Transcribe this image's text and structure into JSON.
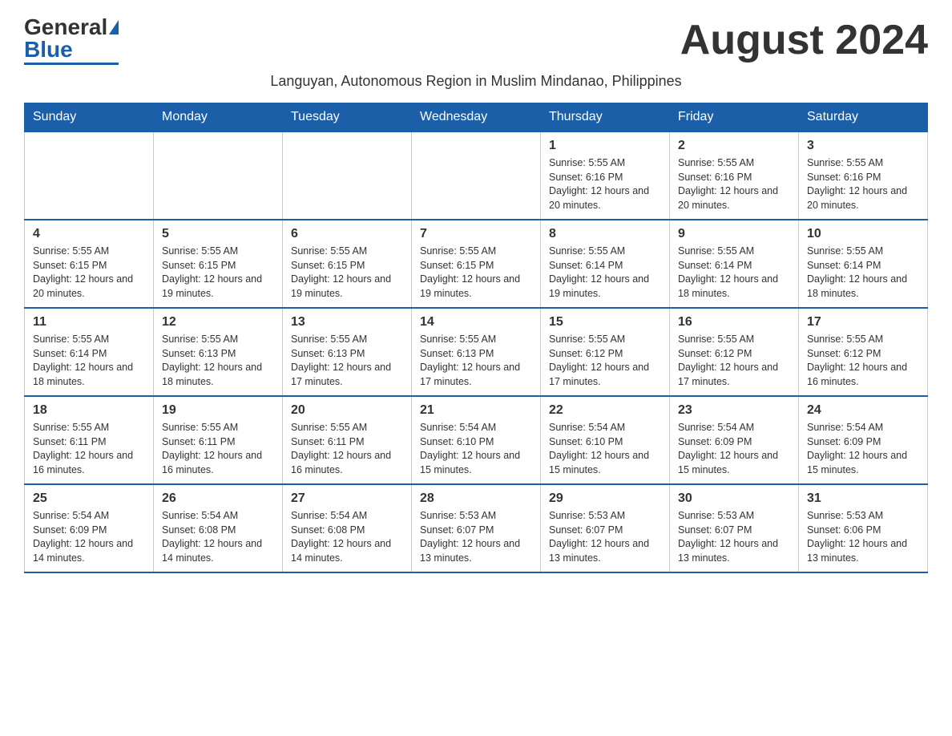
{
  "logo": {
    "general": "General",
    "blue": "Blue"
  },
  "title": "August 2024",
  "subtitle": "Languyan, Autonomous Region in Muslim Mindanao, Philippines",
  "days_of_week": [
    "Sunday",
    "Monday",
    "Tuesday",
    "Wednesday",
    "Thursday",
    "Friday",
    "Saturday"
  ],
  "weeks": [
    [
      {
        "day": "",
        "info": ""
      },
      {
        "day": "",
        "info": ""
      },
      {
        "day": "",
        "info": ""
      },
      {
        "day": "",
        "info": ""
      },
      {
        "day": "1",
        "info": "Sunrise: 5:55 AM\nSunset: 6:16 PM\nDaylight: 12 hours and 20 minutes."
      },
      {
        "day": "2",
        "info": "Sunrise: 5:55 AM\nSunset: 6:16 PM\nDaylight: 12 hours and 20 minutes."
      },
      {
        "day": "3",
        "info": "Sunrise: 5:55 AM\nSunset: 6:16 PM\nDaylight: 12 hours and 20 minutes."
      }
    ],
    [
      {
        "day": "4",
        "info": "Sunrise: 5:55 AM\nSunset: 6:15 PM\nDaylight: 12 hours and 20 minutes."
      },
      {
        "day": "5",
        "info": "Sunrise: 5:55 AM\nSunset: 6:15 PM\nDaylight: 12 hours and 19 minutes."
      },
      {
        "day": "6",
        "info": "Sunrise: 5:55 AM\nSunset: 6:15 PM\nDaylight: 12 hours and 19 minutes."
      },
      {
        "day": "7",
        "info": "Sunrise: 5:55 AM\nSunset: 6:15 PM\nDaylight: 12 hours and 19 minutes."
      },
      {
        "day": "8",
        "info": "Sunrise: 5:55 AM\nSunset: 6:14 PM\nDaylight: 12 hours and 19 minutes."
      },
      {
        "day": "9",
        "info": "Sunrise: 5:55 AM\nSunset: 6:14 PM\nDaylight: 12 hours and 18 minutes."
      },
      {
        "day": "10",
        "info": "Sunrise: 5:55 AM\nSunset: 6:14 PM\nDaylight: 12 hours and 18 minutes."
      }
    ],
    [
      {
        "day": "11",
        "info": "Sunrise: 5:55 AM\nSunset: 6:14 PM\nDaylight: 12 hours and 18 minutes."
      },
      {
        "day": "12",
        "info": "Sunrise: 5:55 AM\nSunset: 6:13 PM\nDaylight: 12 hours and 18 minutes."
      },
      {
        "day": "13",
        "info": "Sunrise: 5:55 AM\nSunset: 6:13 PM\nDaylight: 12 hours and 17 minutes."
      },
      {
        "day": "14",
        "info": "Sunrise: 5:55 AM\nSunset: 6:13 PM\nDaylight: 12 hours and 17 minutes."
      },
      {
        "day": "15",
        "info": "Sunrise: 5:55 AM\nSunset: 6:12 PM\nDaylight: 12 hours and 17 minutes."
      },
      {
        "day": "16",
        "info": "Sunrise: 5:55 AM\nSunset: 6:12 PM\nDaylight: 12 hours and 17 minutes."
      },
      {
        "day": "17",
        "info": "Sunrise: 5:55 AM\nSunset: 6:12 PM\nDaylight: 12 hours and 16 minutes."
      }
    ],
    [
      {
        "day": "18",
        "info": "Sunrise: 5:55 AM\nSunset: 6:11 PM\nDaylight: 12 hours and 16 minutes."
      },
      {
        "day": "19",
        "info": "Sunrise: 5:55 AM\nSunset: 6:11 PM\nDaylight: 12 hours and 16 minutes."
      },
      {
        "day": "20",
        "info": "Sunrise: 5:55 AM\nSunset: 6:11 PM\nDaylight: 12 hours and 16 minutes."
      },
      {
        "day": "21",
        "info": "Sunrise: 5:54 AM\nSunset: 6:10 PM\nDaylight: 12 hours and 15 minutes."
      },
      {
        "day": "22",
        "info": "Sunrise: 5:54 AM\nSunset: 6:10 PM\nDaylight: 12 hours and 15 minutes."
      },
      {
        "day": "23",
        "info": "Sunrise: 5:54 AM\nSunset: 6:09 PM\nDaylight: 12 hours and 15 minutes."
      },
      {
        "day": "24",
        "info": "Sunrise: 5:54 AM\nSunset: 6:09 PM\nDaylight: 12 hours and 15 minutes."
      }
    ],
    [
      {
        "day": "25",
        "info": "Sunrise: 5:54 AM\nSunset: 6:09 PM\nDaylight: 12 hours and 14 minutes."
      },
      {
        "day": "26",
        "info": "Sunrise: 5:54 AM\nSunset: 6:08 PM\nDaylight: 12 hours and 14 minutes."
      },
      {
        "day": "27",
        "info": "Sunrise: 5:54 AM\nSunset: 6:08 PM\nDaylight: 12 hours and 14 minutes."
      },
      {
        "day": "28",
        "info": "Sunrise: 5:53 AM\nSunset: 6:07 PM\nDaylight: 12 hours and 13 minutes."
      },
      {
        "day": "29",
        "info": "Sunrise: 5:53 AM\nSunset: 6:07 PM\nDaylight: 12 hours and 13 minutes."
      },
      {
        "day": "30",
        "info": "Sunrise: 5:53 AM\nSunset: 6:07 PM\nDaylight: 12 hours and 13 minutes."
      },
      {
        "day": "31",
        "info": "Sunrise: 5:53 AM\nSunset: 6:06 PM\nDaylight: 12 hours and 13 minutes."
      }
    ]
  ]
}
